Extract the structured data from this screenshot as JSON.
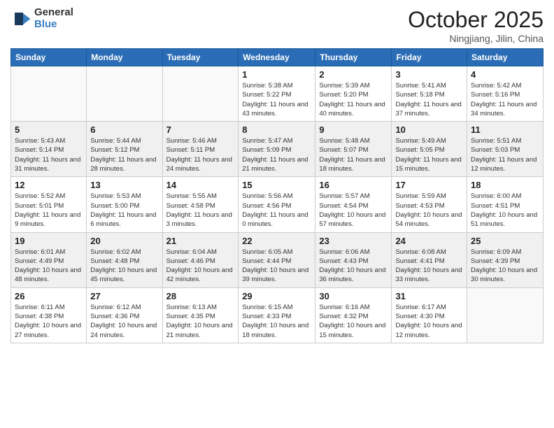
{
  "logo": {
    "general": "General",
    "blue": "Blue"
  },
  "header": {
    "month": "October 2025",
    "location": "Ningjiang, Jilin, China"
  },
  "weekdays": [
    "Sunday",
    "Monday",
    "Tuesday",
    "Wednesday",
    "Thursday",
    "Friday",
    "Saturday"
  ],
  "weeks": [
    [
      {
        "day": "",
        "info": ""
      },
      {
        "day": "",
        "info": ""
      },
      {
        "day": "",
        "info": ""
      },
      {
        "day": "1",
        "info": "Sunrise: 5:38 AM\nSunset: 5:22 PM\nDaylight: 11 hours\nand 43 minutes."
      },
      {
        "day": "2",
        "info": "Sunrise: 5:39 AM\nSunset: 5:20 PM\nDaylight: 11 hours\nand 40 minutes."
      },
      {
        "day": "3",
        "info": "Sunrise: 5:41 AM\nSunset: 5:18 PM\nDaylight: 11 hours\nand 37 minutes."
      },
      {
        "day": "4",
        "info": "Sunrise: 5:42 AM\nSunset: 5:16 PM\nDaylight: 11 hours\nand 34 minutes."
      }
    ],
    [
      {
        "day": "5",
        "info": "Sunrise: 5:43 AM\nSunset: 5:14 PM\nDaylight: 11 hours\nand 31 minutes."
      },
      {
        "day": "6",
        "info": "Sunrise: 5:44 AM\nSunset: 5:12 PM\nDaylight: 11 hours\nand 28 minutes."
      },
      {
        "day": "7",
        "info": "Sunrise: 5:46 AM\nSunset: 5:11 PM\nDaylight: 11 hours\nand 24 minutes."
      },
      {
        "day": "8",
        "info": "Sunrise: 5:47 AM\nSunset: 5:09 PM\nDaylight: 11 hours\nand 21 minutes."
      },
      {
        "day": "9",
        "info": "Sunrise: 5:48 AM\nSunset: 5:07 PM\nDaylight: 11 hours\nand 18 minutes."
      },
      {
        "day": "10",
        "info": "Sunrise: 5:49 AM\nSunset: 5:05 PM\nDaylight: 11 hours\nand 15 minutes."
      },
      {
        "day": "11",
        "info": "Sunrise: 5:51 AM\nSunset: 5:03 PM\nDaylight: 11 hours\nand 12 minutes."
      }
    ],
    [
      {
        "day": "12",
        "info": "Sunrise: 5:52 AM\nSunset: 5:01 PM\nDaylight: 11 hours\nand 9 minutes."
      },
      {
        "day": "13",
        "info": "Sunrise: 5:53 AM\nSunset: 5:00 PM\nDaylight: 11 hours\nand 6 minutes."
      },
      {
        "day": "14",
        "info": "Sunrise: 5:55 AM\nSunset: 4:58 PM\nDaylight: 11 hours\nand 3 minutes."
      },
      {
        "day": "15",
        "info": "Sunrise: 5:56 AM\nSunset: 4:56 PM\nDaylight: 11 hours\nand 0 minutes."
      },
      {
        "day": "16",
        "info": "Sunrise: 5:57 AM\nSunset: 4:54 PM\nDaylight: 10 hours\nand 57 minutes."
      },
      {
        "day": "17",
        "info": "Sunrise: 5:59 AM\nSunset: 4:53 PM\nDaylight: 10 hours\nand 54 minutes."
      },
      {
        "day": "18",
        "info": "Sunrise: 6:00 AM\nSunset: 4:51 PM\nDaylight: 10 hours\nand 51 minutes."
      }
    ],
    [
      {
        "day": "19",
        "info": "Sunrise: 6:01 AM\nSunset: 4:49 PM\nDaylight: 10 hours\nand 48 minutes."
      },
      {
        "day": "20",
        "info": "Sunrise: 6:02 AM\nSunset: 4:48 PM\nDaylight: 10 hours\nand 45 minutes."
      },
      {
        "day": "21",
        "info": "Sunrise: 6:04 AM\nSunset: 4:46 PM\nDaylight: 10 hours\nand 42 minutes."
      },
      {
        "day": "22",
        "info": "Sunrise: 6:05 AM\nSunset: 4:44 PM\nDaylight: 10 hours\nand 39 minutes."
      },
      {
        "day": "23",
        "info": "Sunrise: 6:06 AM\nSunset: 4:43 PM\nDaylight: 10 hours\nand 36 minutes."
      },
      {
        "day": "24",
        "info": "Sunrise: 6:08 AM\nSunset: 4:41 PM\nDaylight: 10 hours\nand 33 minutes."
      },
      {
        "day": "25",
        "info": "Sunrise: 6:09 AM\nSunset: 4:39 PM\nDaylight: 10 hours\nand 30 minutes."
      }
    ],
    [
      {
        "day": "26",
        "info": "Sunrise: 6:11 AM\nSunset: 4:38 PM\nDaylight: 10 hours\nand 27 minutes."
      },
      {
        "day": "27",
        "info": "Sunrise: 6:12 AM\nSunset: 4:36 PM\nDaylight: 10 hours\nand 24 minutes."
      },
      {
        "day": "28",
        "info": "Sunrise: 6:13 AM\nSunset: 4:35 PM\nDaylight: 10 hours\nand 21 minutes."
      },
      {
        "day": "29",
        "info": "Sunrise: 6:15 AM\nSunset: 4:33 PM\nDaylight: 10 hours\nand 18 minutes."
      },
      {
        "day": "30",
        "info": "Sunrise: 6:16 AM\nSunset: 4:32 PM\nDaylight: 10 hours\nand 15 minutes."
      },
      {
        "day": "31",
        "info": "Sunrise: 6:17 AM\nSunset: 4:30 PM\nDaylight: 10 hours\nand 12 minutes."
      },
      {
        "day": "",
        "info": ""
      }
    ]
  ]
}
